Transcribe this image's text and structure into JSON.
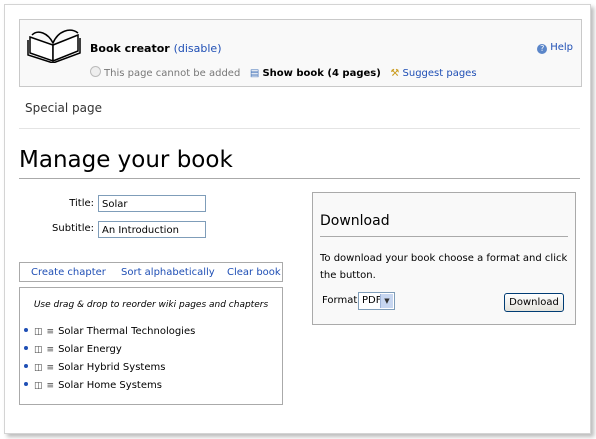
{
  "bookbar": {
    "title": "Book creator",
    "disable_link": "disable",
    "cannot_add": "This page cannot be added",
    "show_book": "Show book (4 pages)",
    "suggest": "Suggest pages",
    "help": "Help"
  },
  "special_page": "Special page",
  "page_title": "Manage your book",
  "form": {
    "title_label": "Title:",
    "title_value": "Solar",
    "subtitle_label": "Subtitle:",
    "subtitle_value": "An Introduction"
  },
  "tools": {
    "create_chapter": "Create chapter",
    "sort": "Sort alphabetically",
    "clear": "Clear book"
  },
  "chapters": {
    "hint": "Use drag & drop to reorder wiki pages and chapters",
    "items": [
      "Solar Thermal Technologies",
      "Solar Energy",
      "Solar Hybrid Systems",
      "Solar Home Systems"
    ]
  },
  "download": {
    "title": "Download",
    "description": "To download your book choose a format and click the button.",
    "format_label": "Format:",
    "format_value": "PDF",
    "button": "Download"
  },
  "colors": {
    "link": "#1f4fb5",
    "box_bg": "#f9f9f9"
  },
  "icons": [
    "book-logo-icon",
    "help-icon",
    "show-book-icon",
    "suggest-pages-icon",
    "trash-icon",
    "reorder-icon"
  ]
}
